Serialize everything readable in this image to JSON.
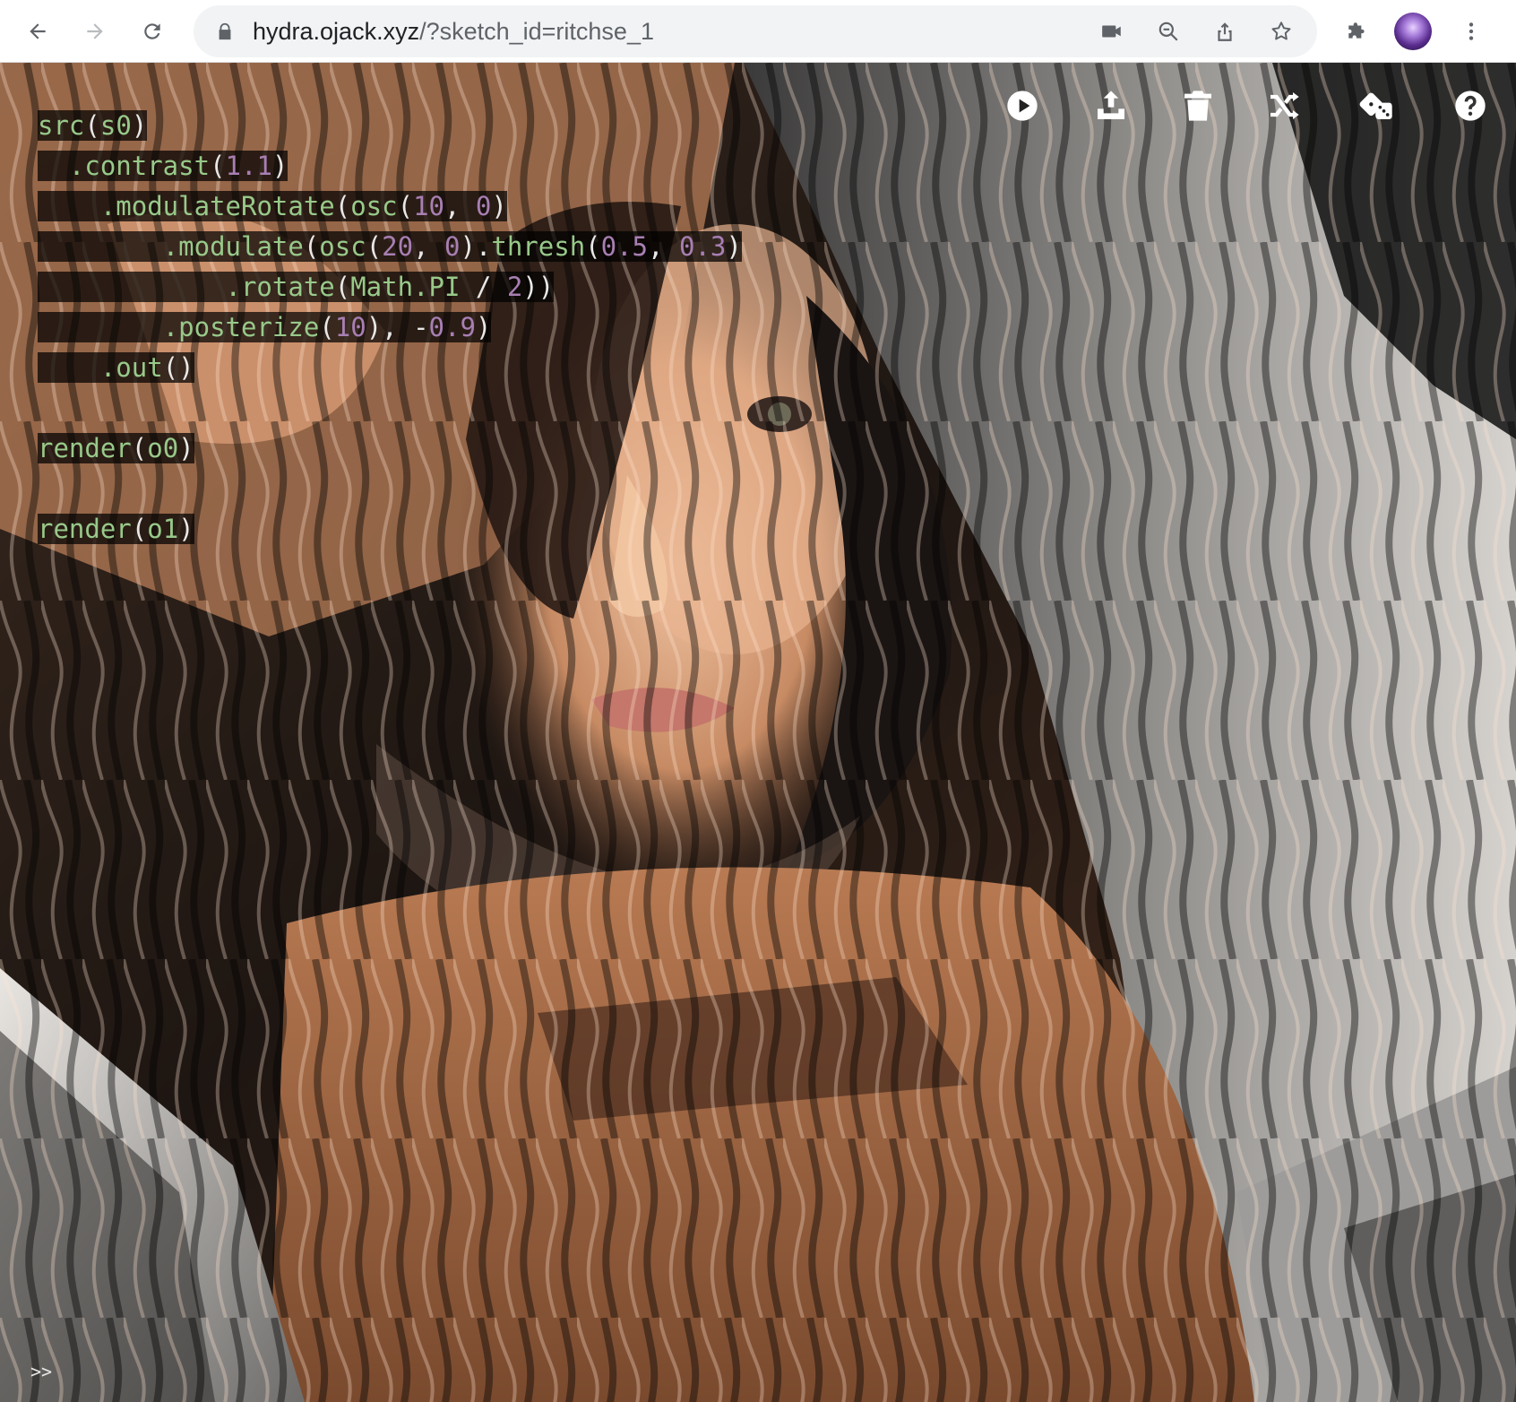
{
  "browser": {
    "url_host": "hydra.ojack.xyz",
    "url_path": "/?sketch_id=ritchse_1",
    "icons": [
      "back-icon",
      "forward-icon",
      "reload-icon",
      "lock-icon",
      "camera-icon",
      "zoom-out-icon",
      "share-icon",
      "bookmark-star-icon",
      "extensions-icon",
      "profile-avatar",
      "more-menu-icon"
    ]
  },
  "hydra": {
    "toolbar_icons": [
      "run-icon",
      "upload-icon",
      "clear-icon",
      "shuffle-icon",
      "random-icon",
      "help-icon"
    ],
    "code": [
      {
        "indent": "",
        "tokens": [
          {
            "t": "src",
            "c": "fn"
          },
          {
            "t": "(",
            "c": "pn"
          },
          {
            "t": "s0",
            "c": "fn"
          },
          {
            "t": ")",
            "c": "pn"
          }
        ]
      },
      {
        "indent": "  ",
        "tokens": [
          {
            "t": ".contrast",
            "c": "fn"
          },
          {
            "t": "(",
            "c": "pn"
          },
          {
            "t": "1.1",
            "c": "num"
          },
          {
            "t": ")",
            "c": "pn"
          }
        ]
      },
      {
        "indent": "    ",
        "tokens": [
          {
            "t": ".modulateRotate",
            "c": "fn"
          },
          {
            "t": "(",
            "c": "pn"
          },
          {
            "t": "osc",
            "c": "fn"
          },
          {
            "t": "(",
            "c": "pn"
          },
          {
            "t": "10",
            "c": "num"
          },
          {
            "t": ", ",
            "c": "pn"
          },
          {
            "t": "0",
            "c": "num"
          },
          {
            "t": ")",
            "c": "pn"
          }
        ]
      },
      {
        "indent": "        ",
        "tokens": [
          {
            "t": ".modulate",
            "c": "fn"
          },
          {
            "t": "(",
            "c": "pn"
          },
          {
            "t": "osc",
            "c": "fn"
          },
          {
            "t": "(",
            "c": "pn"
          },
          {
            "t": "20",
            "c": "num"
          },
          {
            "t": ", ",
            "c": "pn"
          },
          {
            "t": "0",
            "c": "num"
          },
          {
            "t": ").",
            "c": "pn"
          },
          {
            "t": "thresh",
            "c": "fn"
          },
          {
            "t": "(",
            "c": "pn"
          },
          {
            "t": "0.5",
            "c": "num"
          },
          {
            "t": ", ",
            "c": "pn"
          },
          {
            "t": "0.3",
            "c": "num"
          },
          {
            "t": ")",
            "c": "pn"
          }
        ]
      },
      {
        "indent": "            ",
        "tokens": [
          {
            "t": ".rotate",
            "c": "fn"
          },
          {
            "t": "(",
            "c": "pn"
          },
          {
            "t": "Math.PI",
            "c": "fn"
          },
          {
            "t": " / ",
            "c": "pn"
          },
          {
            "t": "2",
            "c": "num"
          },
          {
            "t": "))",
            "c": "pn"
          }
        ]
      },
      {
        "indent": "        ",
        "tokens": [
          {
            "t": ".posterize",
            "c": "fn"
          },
          {
            "t": "(",
            "c": "pn"
          },
          {
            "t": "10",
            "c": "num"
          },
          {
            "t": "), -",
            "c": "pn"
          },
          {
            "t": "0.9",
            "c": "num"
          },
          {
            "t": ")",
            "c": "pn"
          }
        ]
      },
      {
        "indent": "    ",
        "tokens": [
          {
            "t": ".out",
            "c": "fn"
          },
          {
            "t": "()",
            "c": "pn"
          }
        ]
      },
      {
        "indent": "",
        "tokens": []
      },
      {
        "indent": "",
        "tokens": [
          {
            "t": "render",
            "c": "fn"
          },
          {
            "t": "(",
            "c": "pn"
          },
          {
            "t": "o0",
            "c": "fn"
          },
          {
            "t": ")",
            "c": "pn"
          }
        ]
      },
      {
        "indent": "",
        "tokens": []
      },
      {
        "indent": "",
        "tokens": [
          {
            "t": "render",
            "c": "fn"
          },
          {
            "t": "(",
            "c": "pn"
          },
          {
            "t": "o1",
            "c": "fn"
          },
          {
            "t": ")",
            "c": "pn"
          }
        ]
      }
    ],
    "console_prompt": ">>"
  },
  "colors": {
    "code_function": "#98c98a",
    "code_number": "#a87fb3",
    "code_punctuation": "#e8e8e8",
    "code_background": "rgba(0,0,0,0.72)"
  }
}
